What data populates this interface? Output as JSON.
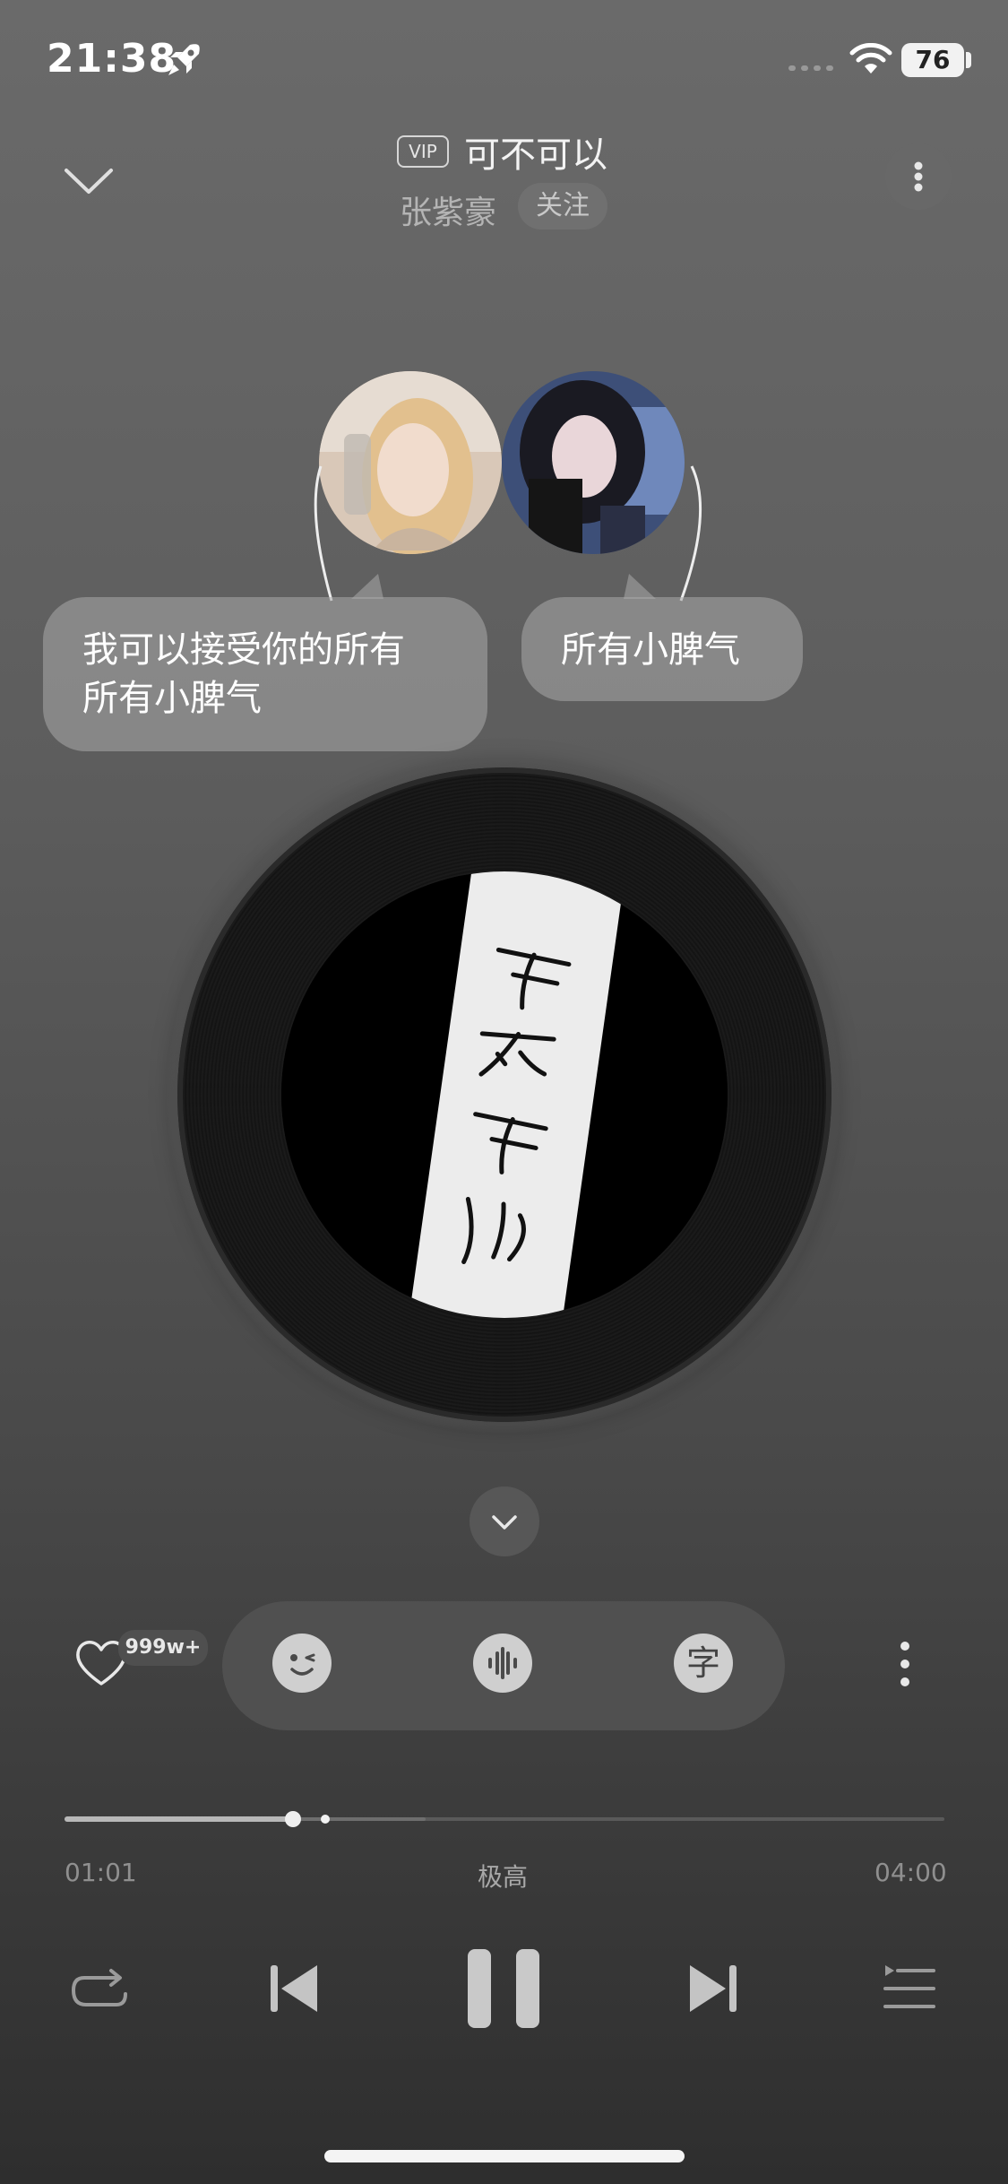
{
  "status_bar": {
    "time": "21:38",
    "battery": "76",
    "icons": [
      "rocket-icon",
      "signal-icon",
      "wifi-icon",
      "battery-icon"
    ]
  },
  "header": {
    "vip_label": "VIP",
    "title": "可不可以",
    "artist": "张紫豪",
    "follow_label": "关注"
  },
  "bubbles": [
    {
      "line1": "我可以接受你的所有",
      "line2": "所有小脾气"
    },
    {
      "line1": "所有小脾气"
    }
  ],
  "actions": {
    "like_count": "999w+",
    "icons": [
      "emoji-wink-icon",
      "audio-wave-icon",
      "lyrics-zi-icon"
    ],
    "lyrics_glyph": "字"
  },
  "player": {
    "current_time": "01:01",
    "quality": "极高",
    "total_time": "04:00",
    "progress_fraction": 0.26,
    "buffered_fraction": 0.41
  },
  "controls": {
    "icons": [
      "repeat-icon",
      "previous-icon",
      "pause-icon",
      "next-icon",
      "playlist-icon"
    ]
  },
  "colors": {
    "background_top": "#6a6a6a",
    "background_bottom": "#2e2e2e",
    "accent_light": "#cfcfcf"
  }
}
